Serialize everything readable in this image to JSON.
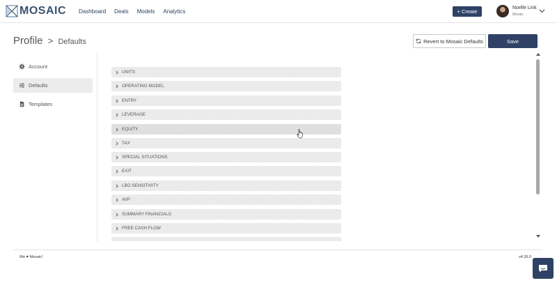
{
  "brand": {
    "name": "MOSAIC"
  },
  "nav": {
    "items": [
      "Dashboard",
      "Deals",
      "Models",
      "Analytics"
    ]
  },
  "header": {
    "create_label": "+ Create",
    "user_name": "Noelle Link",
    "user_org": "Mosaic"
  },
  "page": {
    "title": "Profile",
    "separator": ">",
    "subtitle": "Defaults",
    "revert_label": "Revert to Mosaic Defaults",
    "save_label": "Save"
  },
  "sidebar": {
    "items": [
      {
        "label": "Account",
        "icon": "gear-icon"
      },
      {
        "label": "Defaults",
        "icon": "sliders-icon",
        "active": true
      },
      {
        "label": "Templates",
        "icon": "document-icon"
      }
    ]
  },
  "sections": [
    "UNITS",
    "OPERATING MODEL",
    "ENTRY",
    "LEVERAGE",
    "EQUITY",
    "TAX",
    "SPECIAL SITUATIONS",
    "EXIT",
    "LBO SENSITIVITY",
    "AVP",
    "SUMMARY FINANCIALS",
    "FREE CASH FLOW"
  ],
  "footer": {
    "left": "We ♥ Mosaic!",
    "version": "v4.26.0"
  },
  "colors": {
    "primary": "#2f4266",
    "brand_text": "#3a5170"
  }
}
